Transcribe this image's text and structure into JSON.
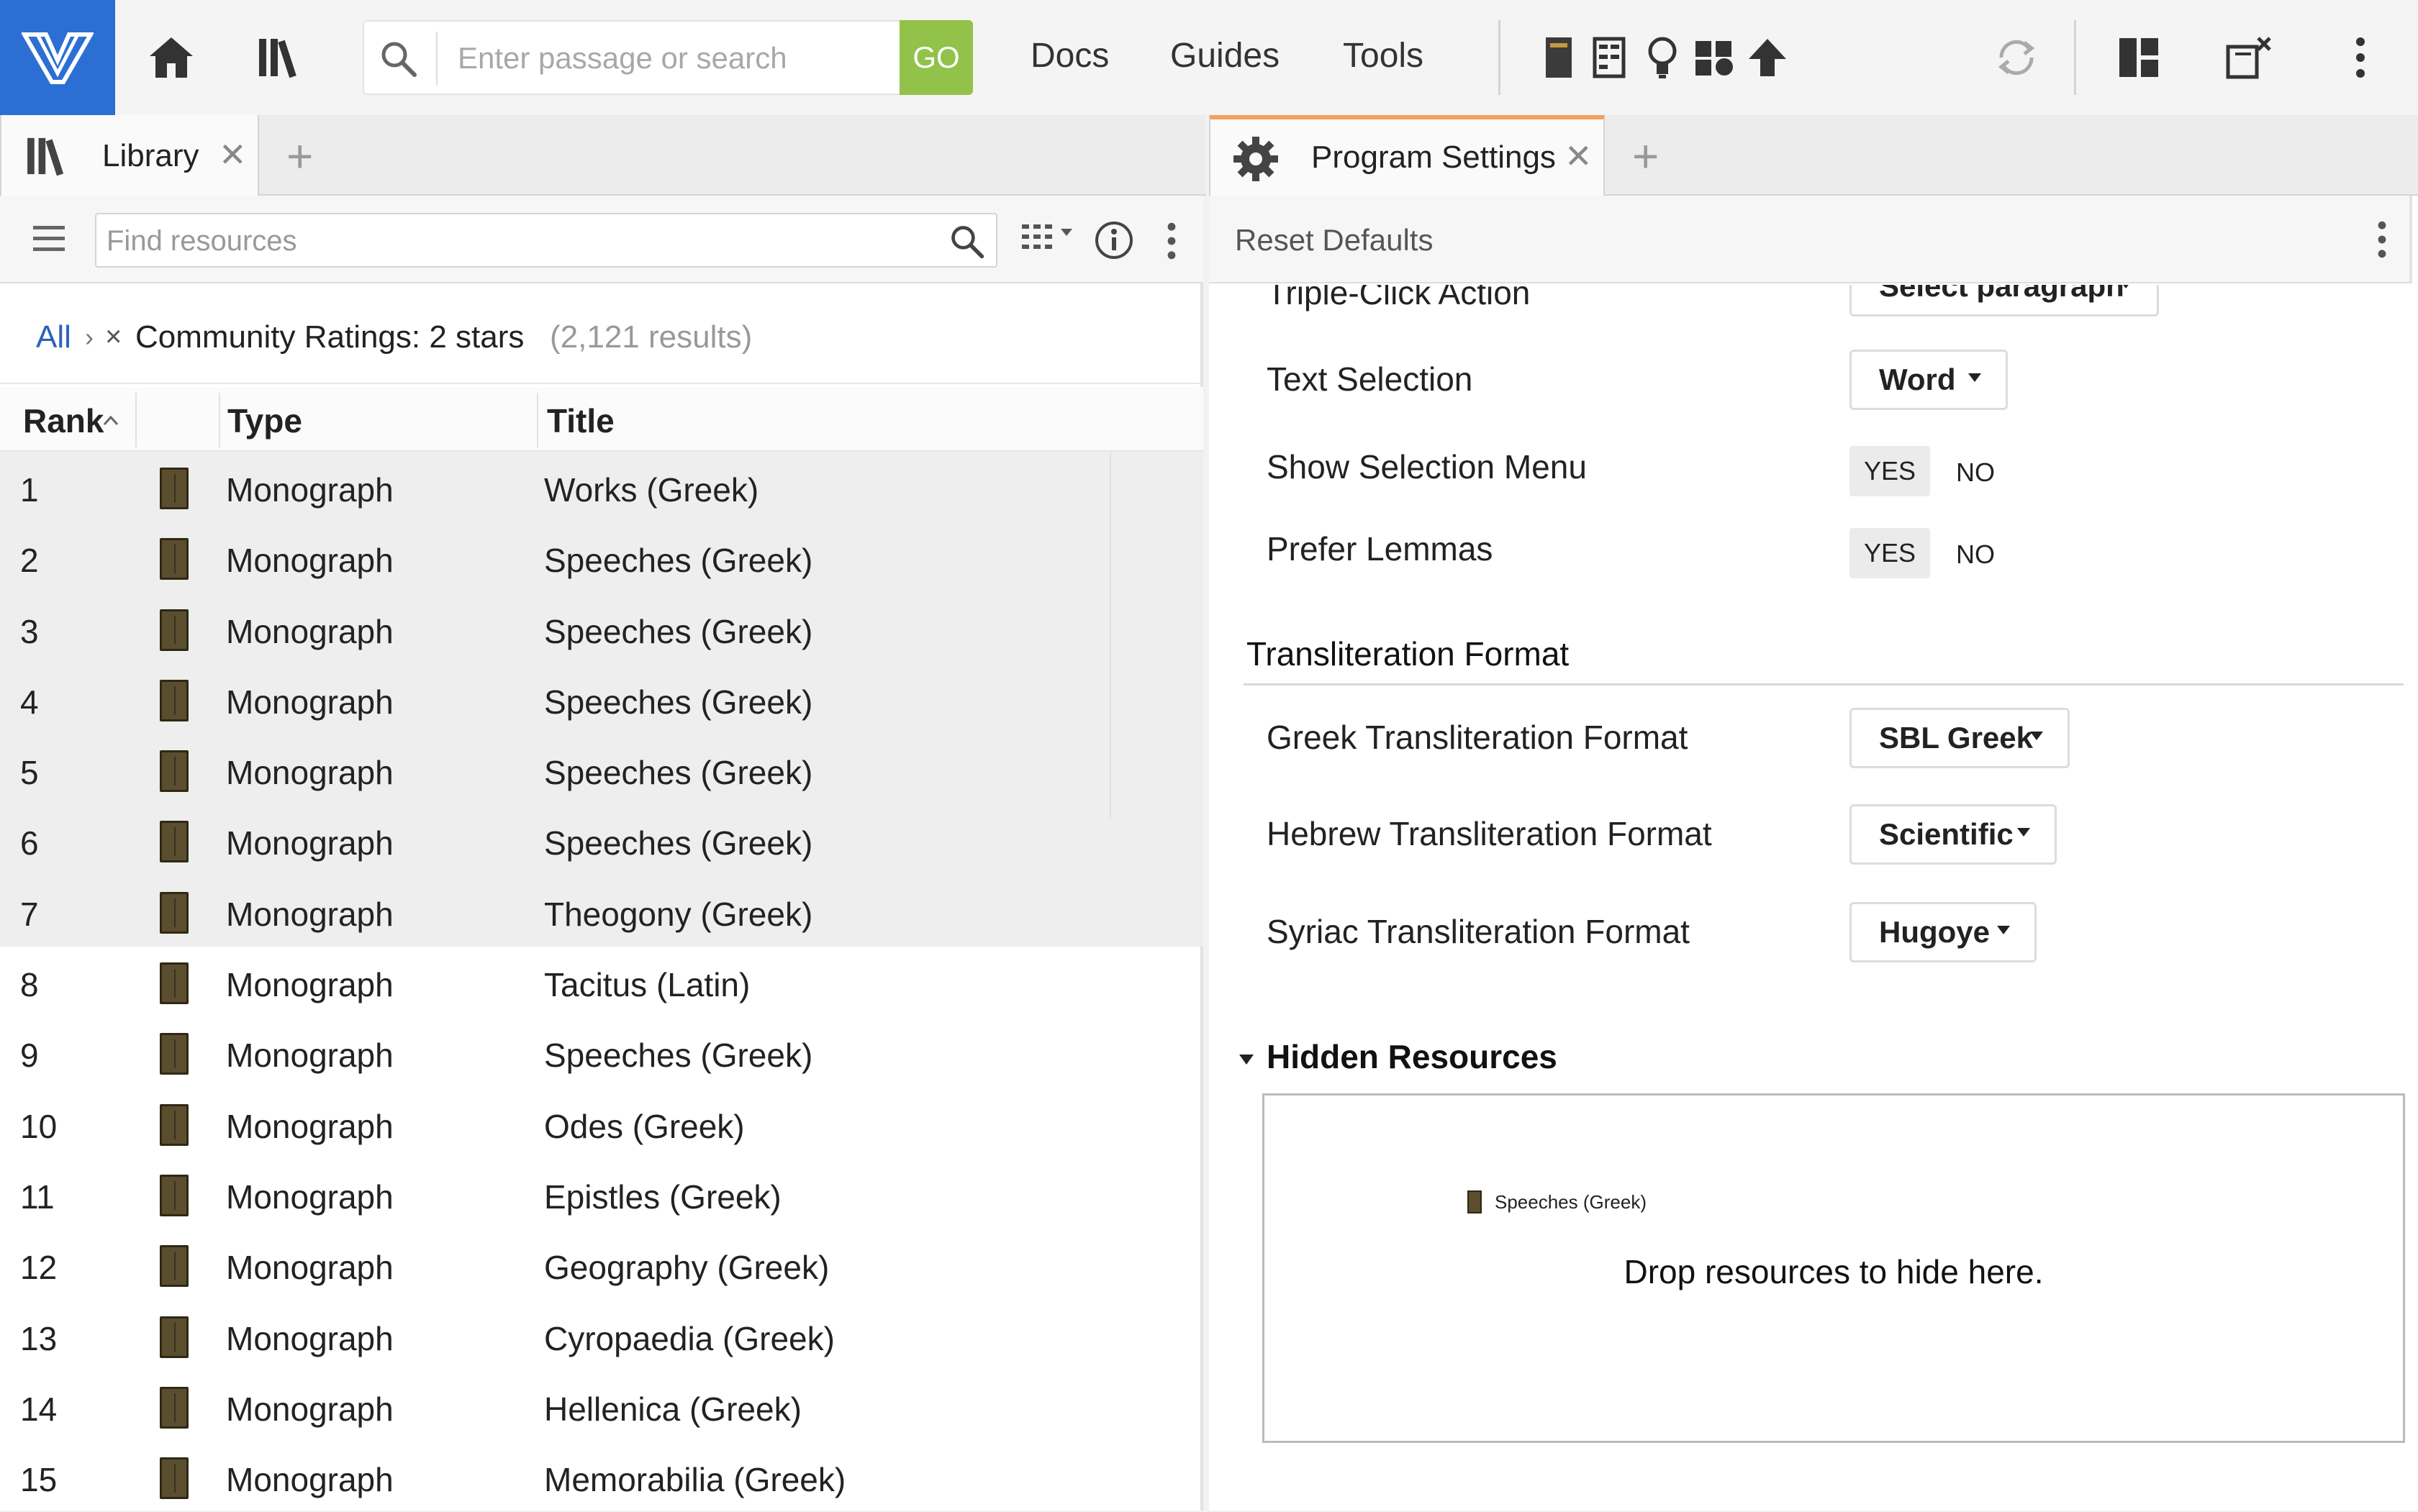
{
  "toolbar": {
    "search_placeholder": "Enter passage or search",
    "go_label": "GO",
    "menu": [
      "Docs",
      "Guides",
      "Tools"
    ]
  },
  "library_tab": {
    "label": "Library"
  },
  "settings_tab": {
    "label": "Program Settings"
  },
  "library": {
    "find_placeholder": "Find resources",
    "breadcrumb": {
      "all": "All",
      "filter": "Community Ratings: 2 stars",
      "count": "(2,121 results)"
    },
    "columns": {
      "rank": "Rank",
      "type": "Type",
      "title": "Title"
    },
    "rows": [
      {
        "rank": "1",
        "type": "Monograph",
        "title": "Works (Greek)"
      },
      {
        "rank": "2",
        "type": "Monograph",
        "title": "Speeches (Greek)"
      },
      {
        "rank": "3",
        "type": "Monograph",
        "title": "Speeches (Greek)"
      },
      {
        "rank": "4",
        "type": "Monograph",
        "title": "Speeches (Greek)"
      },
      {
        "rank": "5",
        "type": "Monograph",
        "title": "Speeches (Greek)"
      },
      {
        "rank": "6",
        "type": "Monograph",
        "title": "Speeches (Greek)"
      },
      {
        "rank": "7",
        "type": "Monograph",
        "title": "Theogony (Greek)"
      },
      {
        "rank": "8",
        "type": "Monograph",
        "title": "Tacitus (Latin)"
      },
      {
        "rank": "9",
        "type": "Monograph",
        "title": "Speeches (Greek)"
      },
      {
        "rank": "10",
        "type": "Monograph",
        "title": "Odes (Greek)"
      },
      {
        "rank": "11",
        "type": "Monograph",
        "title": "Epistles (Greek)"
      },
      {
        "rank": "12",
        "type": "Monograph",
        "title": "Geography (Greek)"
      },
      {
        "rank": "13",
        "type": "Monograph",
        "title": "Cyropaedia (Greek)"
      },
      {
        "rank": "14",
        "type": "Monograph",
        "title": "Hellenica (Greek)"
      },
      {
        "rank": "15",
        "type": "Monograph",
        "title": "Memorabilia (Greek)"
      }
    ]
  },
  "settings": {
    "reset_label": "Reset Defaults",
    "triple_click": {
      "label": "Triple-Click Action",
      "value": "Select paragraph"
    },
    "text_selection": {
      "label": "Text Selection",
      "value": "Word"
    },
    "show_selection_menu": {
      "label": "Show Selection Menu",
      "yes": "YES",
      "no": "NO"
    },
    "prefer_lemmas": {
      "label": "Prefer Lemmas",
      "yes": "YES",
      "no": "NO"
    },
    "transliteration": {
      "heading": "Transliteration Format",
      "greek": {
        "label": "Greek Transliteration Format",
        "value": "SBL Greek"
      },
      "hebrew": {
        "label": "Hebrew Transliteration Format",
        "value": "Scientific"
      },
      "syriac": {
        "label": "Syriac Transliteration Format",
        "value": "Hugoye"
      }
    },
    "hidden_resources": {
      "heading": "Hidden Resources",
      "item": "Speeches (Greek)",
      "drop_text": "Drop resources to hide here."
    }
  }
}
